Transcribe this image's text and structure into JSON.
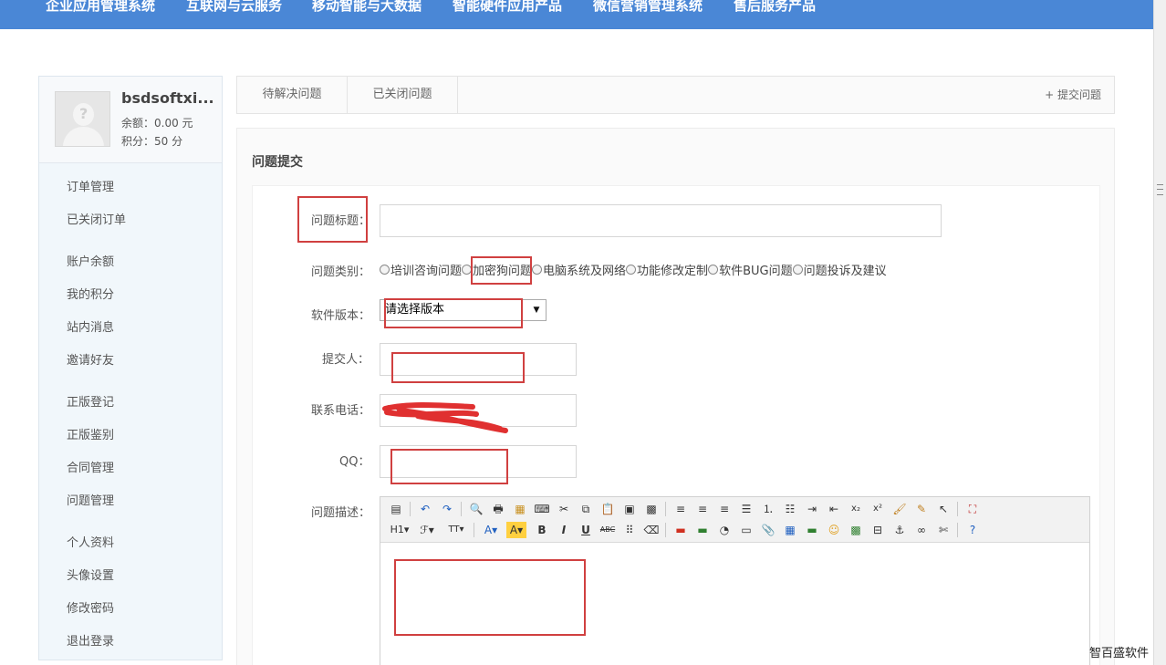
{
  "topnav": {
    "items": [
      "企业应用管理系统",
      "互联网与云服务",
      "移动智能与大数据",
      "智能硬件应用产品",
      "微信营销管理系统",
      "售后服务产品"
    ]
  },
  "user": {
    "name": "bsdsoftxi...",
    "balance": "余额：0.00 元",
    "points": "积分：50 分"
  },
  "sidebar": {
    "items": [
      "订单管理",
      "已关闭订单",
      "账户余额",
      "我的积分",
      "站内消息",
      "邀请好友",
      "正版登记",
      "正版鉴别",
      "合同管理",
      "问题管理",
      "个人资料",
      "头像设置",
      "修改密码",
      "退出登录"
    ]
  },
  "tabs": {
    "pending": "待解决问题",
    "closed": "已关闭问题",
    "submit": "+ 提交问题"
  },
  "form": {
    "section_title": "问题提交",
    "title_label": "问题标题：",
    "title_value": "",
    "category_label": "问题类别：",
    "categories": [
      "培训咨询问题",
      "加密狗问题",
      "电脑系统及网络",
      "功能修改定制",
      "软件BUG问题",
      "问题投诉及建议"
    ],
    "version_label": "软件版本：",
    "version_selected": "请选择版本",
    "submitter_label": "提交人：",
    "submitter_value": "",
    "phone_label": "联系电话：",
    "phone_value": "13",
    "qq_label": "QQ：",
    "qq_value": "",
    "desc_label": "问题描述："
  },
  "editor": {
    "heading": "H1",
    "font_size": "TT",
    "bold": "B",
    "italic": "I",
    "underline": "U",
    "strike": "ABC",
    "sub": "x₂",
    "sup": "x²"
  },
  "watermark": "智百盛软件",
  "colors": {
    "nav": "#4a87d6",
    "annotation": "#d04040"
  }
}
